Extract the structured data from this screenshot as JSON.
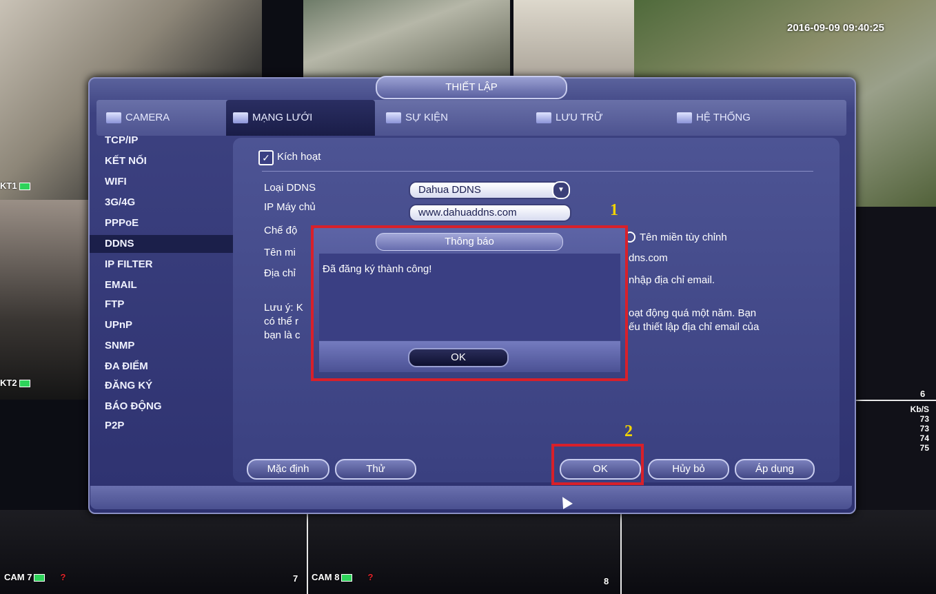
{
  "overlay": {
    "timestamp": "2016-09-09 09:40:25",
    "cam_kt1": "KT1",
    "cam_kt2": "KT2",
    "cam7": "CAM 7",
    "cam8": "CAM 8",
    "num7": "7",
    "num8": "8",
    "num6": "6",
    "question_mark": "?",
    "rate_header": "Kb/S",
    "rates": [
      "73",
      "73",
      "74",
      "75"
    ]
  },
  "window": {
    "title": "THIẾT LẬP",
    "tabs": [
      {
        "label": "CAMERA",
        "icon": "camera-icon"
      },
      {
        "label": "MẠNG LƯỚI",
        "icon": "network-icon"
      },
      {
        "label": "SỰ KIỆN",
        "icon": "event-icon"
      },
      {
        "label": "LƯU TRỮ",
        "icon": "storage-icon"
      },
      {
        "label": "HỆ THỐNG",
        "icon": "system-icon"
      }
    ]
  },
  "sidebar": {
    "items": [
      "TCP/IP",
      "KẾT NỐI",
      "WIFI",
      "3G/4G",
      "PPPoE",
      "DDNS",
      "IP FILTER",
      "EMAIL",
      "FTP",
      "UPnP",
      "SNMP",
      "ĐA ĐIỂM",
      "ĐĂNG KÝ",
      "BÁO ĐỘNG",
      "P2P"
    ],
    "selected": "DDNS"
  },
  "form": {
    "enable_label": "Kích hoạt",
    "ddns_type_label": "Loại DDNS",
    "ddns_type_value": "Dahua DDNS",
    "server_ip_label": "IP Máy chủ",
    "server_ip_value": "www.dahuaddns.com",
    "mode_label": "Chế độ",
    "mode_option_custom": "Tên miền tùy chỉnh",
    "domain_label": "Tên mi",
    "domain_suffix": "dns.com",
    "email_label": "Địa chỉ",
    "email_hint": "nhập địa chỉ email.",
    "note_left_1": "Lưu ý: K",
    "note_left_2": "có thể r",
    "note_left_3": "bạn là c",
    "note_right_1": "oạt động quá một năm. Bạn",
    "note_right_2": "ếu thiết lập địa chỉ email của"
  },
  "buttons": {
    "default": "Mặc định",
    "test": "Thử",
    "ok": "OK",
    "cancel": "Hủy bỏ",
    "apply": "Áp dụng"
  },
  "popup": {
    "title": "Thông báo",
    "message": "Đã đăng ký thành công!",
    "ok": "OK"
  },
  "annotations": {
    "marker_1": "1",
    "marker_2": "2"
  }
}
